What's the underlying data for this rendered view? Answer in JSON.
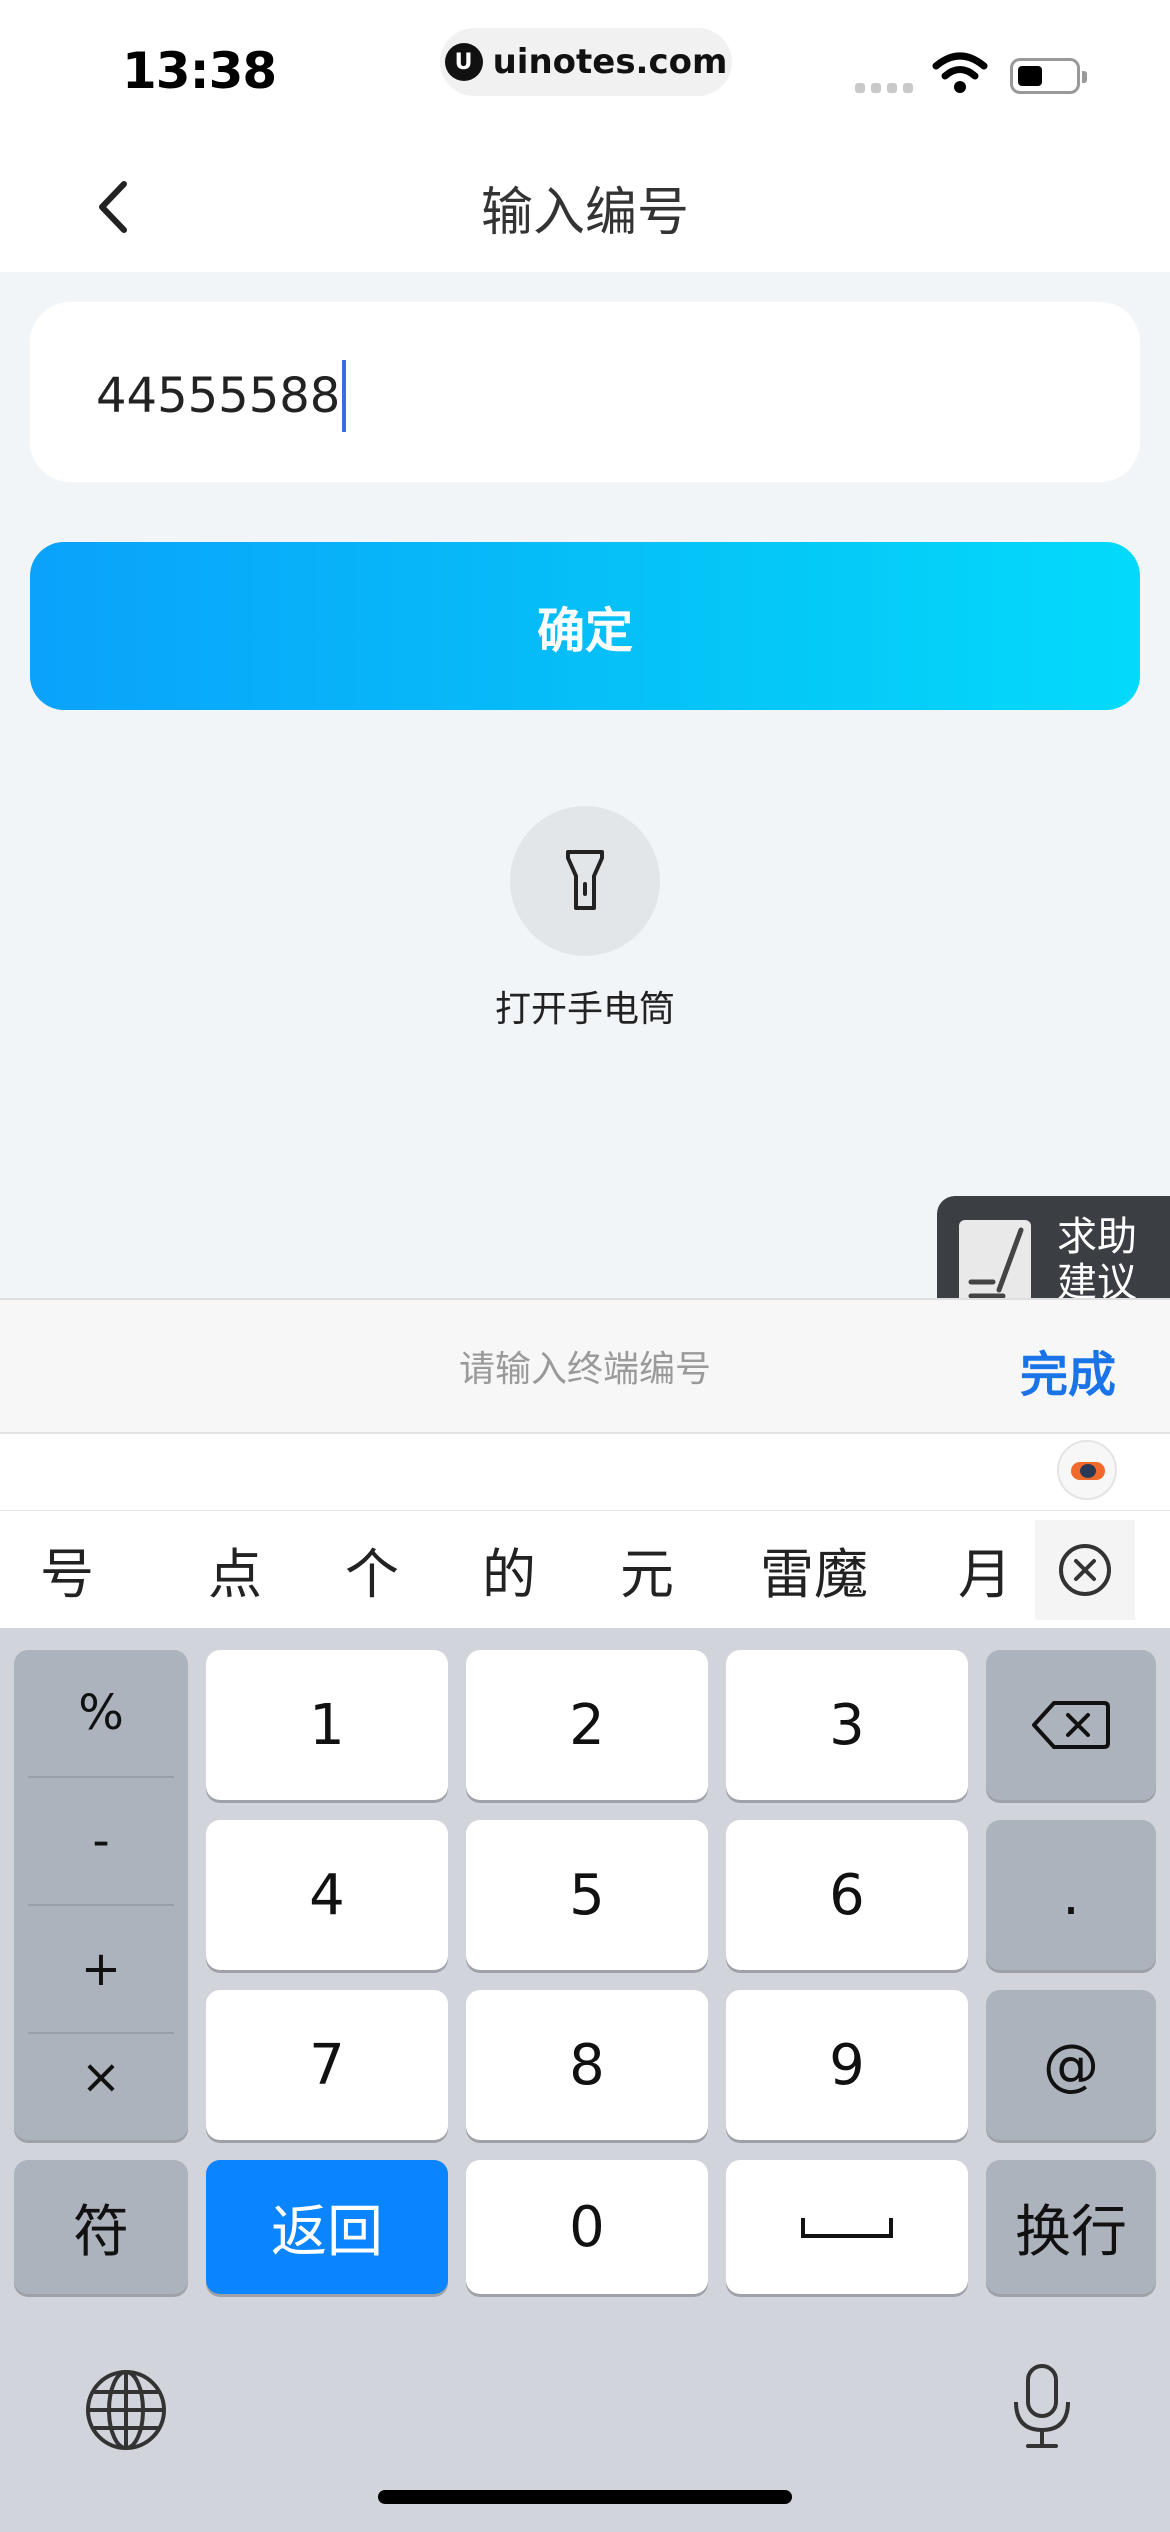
{
  "status_bar": {
    "time": "13:38",
    "url": "uinotes.com",
    "url_logo": "U"
  },
  "nav": {
    "title": "输入编号"
  },
  "input": {
    "value": "44555588"
  },
  "confirm": {
    "label": "确定"
  },
  "flashlight": {
    "label": "打开手电筒"
  },
  "help": {
    "line1": "求助",
    "line2": "建议"
  },
  "accessory": {
    "placeholder": "请输入终端编号",
    "done_label": "完成"
  },
  "candidates": [
    "号",
    "点",
    "个",
    "的",
    "元",
    "雷魔",
    "月"
  ],
  "keyboard": {
    "symbols": [
      "%",
      "-",
      "+",
      "×"
    ],
    "digits": [
      "1",
      "2",
      "3",
      "4",
      "5",
      "6",
      "7",
      "8",
      "9",
      "0"
    ],
    "dot": ".",
    "at": "@",
    "fu": "符",
    "return": "返回",
    "newline": "换行"
  },
  "colors": {
    "accent_blue": "#0a84ff",
    "done_blue": "#1a74e8",
    "button_gradient_start": "#0aa2fb",
    "button_gradient_end": "#03dafb"
  },
  "icons": [
    "back-chevron-icon",
    "wifi-icon",
    "battery-icon",
    "flashlight-icon",
    "backspace-icon",
    "globe-icon",
    "microphone-icon",
    "close-circle-icon"
  ]
}
